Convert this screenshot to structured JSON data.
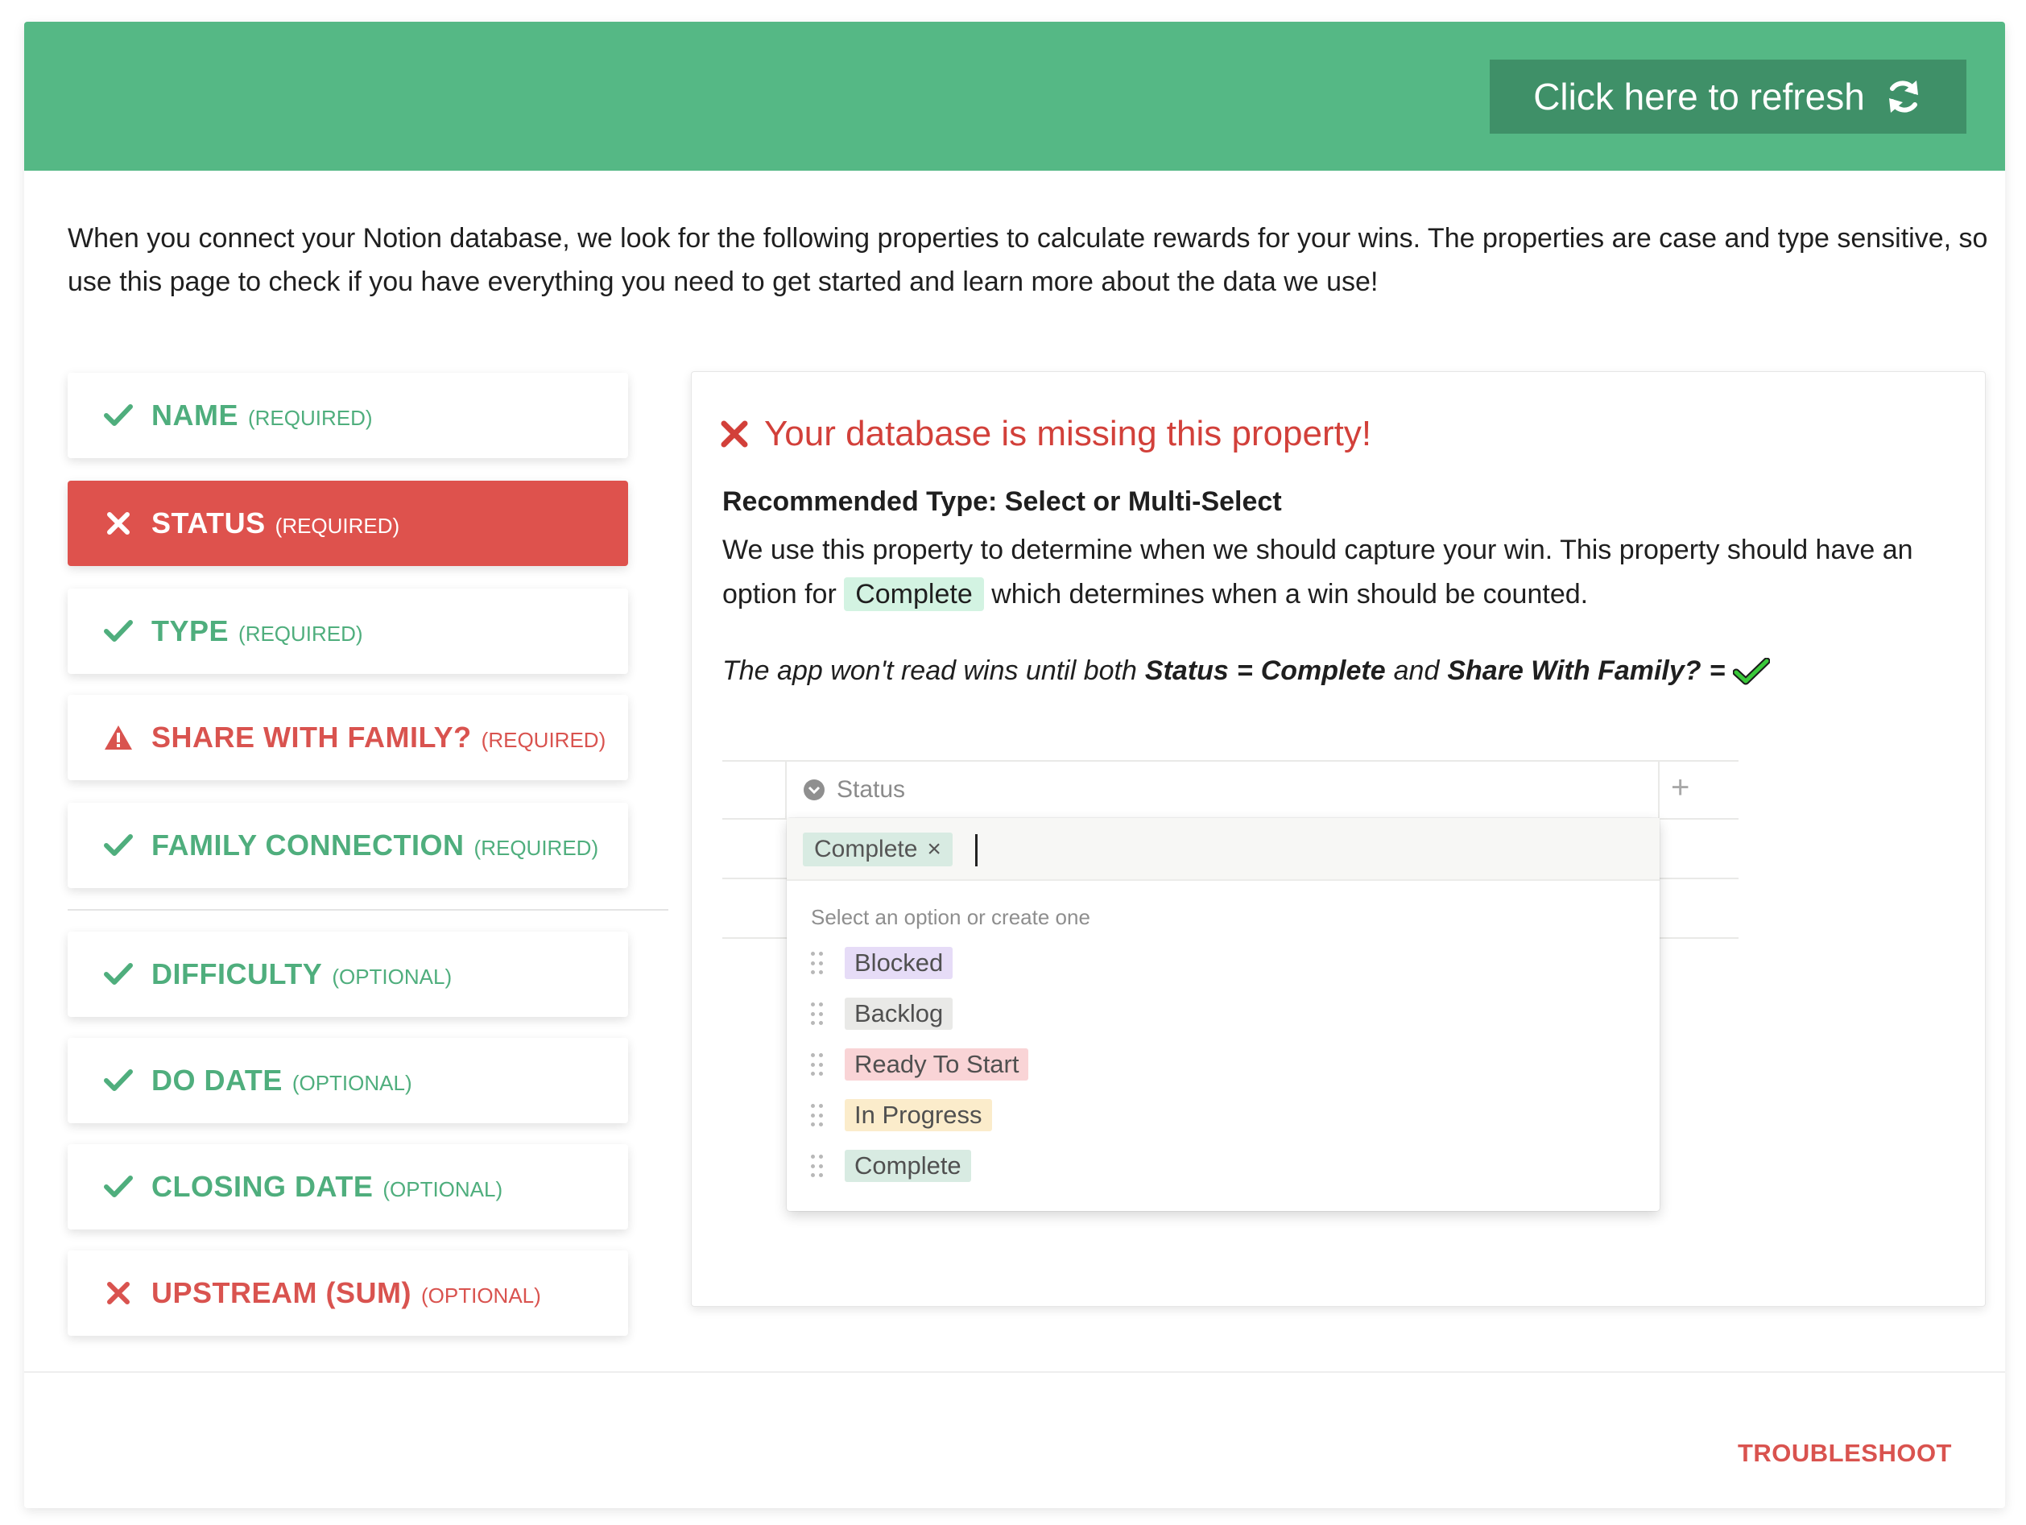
{
  "header": {
    "refresh_label": "Click here to refresh"
  },
  "intro": "When you connect your Notion database, we look for the following properties to calculate rewards for your wins. The properties are case and type sensitive, so use this page to check if you have everything you need to get started and learn more about the data we use!",
  "properties": [
    {
      "name": "NAME",
      "tag": "(REQUIRED)",
      "state": "ok"
    },
    {
      "name": "STATUS",
      "tag": "(REQUIRED)",
      "state": "active"
    },
    {
      "name": "TYPE",
      "tag": "(REQUIRED)",
      "state": "ok"
    },
    {
      "name": "SHARE WITH FAMILY?",
      "tag": "(REQUIRED)",
      "state": "warn"
    },
    {
      "name": "FAMILY CONNECTION",
      "tag": "(REQUIRED)",
      "state": "ok"
    },
    {
      "name": "DIFFICULTY",
      "tag": "(OPTIONAL)",
      "state": "ok"
    },
    {
      "name": "DO DATE",
      "tag": "(OPTIONAL)",
      "state": "ok"
    },
    {
      "name": "CLOSING DATE",
      "tag": "(OPTIONAL)",
      "state": "ok"
    },
    {
      "name": "UPSTREAM (SUM)",
      "tag": "(OPTIONAL)",
      "state": "bad"
    }
  ],
  "detail": {
    "title": "Your database is missing this property!",
    "recommended": "Recommended Type: Select or Multi-Select",
    "desc_before": "We use this property to determine when we should capture your win. This property should have an option for",
    "desc_pill": "Complete",
    "desc_after": "which determines when a win should be counted.",
    "note_1": "The app won't read wins until both",
    "note_status": "Status",
    "note_eq1": "=",
    "note_complete": "Complete",
    "note_and": "and",
    "note_share": "Share With Family?",
    "note_eq2": "="
  },
  "mock": {
    "column": "Status",
    "selected_chip": "Complete",
    "chip_remove": "×",
    "hint": "Select an option or create one",
    "plus": "+",
    "options": [
      {
        "label": "Blocked",
        "color": "#e6dcf7"
      },
      {
        "label": "Backlog",
        "color": "#e9e9e7"
      },
      {
        "label": "Ready To Start",
        "color": "#f9d4d6"
      },
      {
        "label": "In Progress",
        "color": "#fbeccb"
      },
      {
        "label": "Complete",
        "color": "#d8ebe2"
      }
    ]
  },
  "footer": {
    "troubleshoot": "TROUBLESHOOT"
  },
  "colors": {
    "green": "#55b885",
    "green_dark": "#3f9068",
    "red": "#de524d",
    "ok_text": "#4fae7d"
  }
}
